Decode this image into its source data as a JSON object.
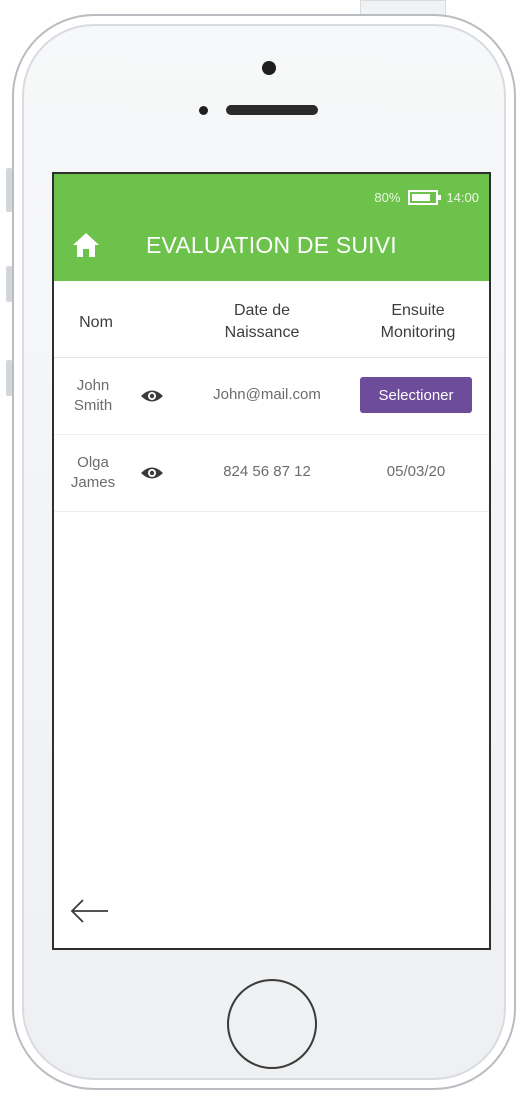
{
  "status": {
    "battery": "80%",
    "time": "14:00"
  },
  "header": {
    "title": "EVALUATION DE SUIVI"
  },
  "table": {
    "columns": [
      "Nom",
      "Date de\nNaissance",
      "Ensuite\nMonitoring"
    ],
    "rows": [
      {
        "first": "John",
        "last": "Smith",
        "contact": "John@mail.com",
        "action": "Selectioner"
      },
      {
        "first": "Olga",
        "last": "James",
        "contact": "824 56 87 12",
        "date": "05/03/20"
      }
    ]
  },
  "colors": {
    "appbar": "#6cc24a",
    "button": "#6e4c9c"
  },
  "icons": [
    "home-icon",
    "eye-icon",
    "back-arrow-icon",
    "battery-icon"
  ]
}
